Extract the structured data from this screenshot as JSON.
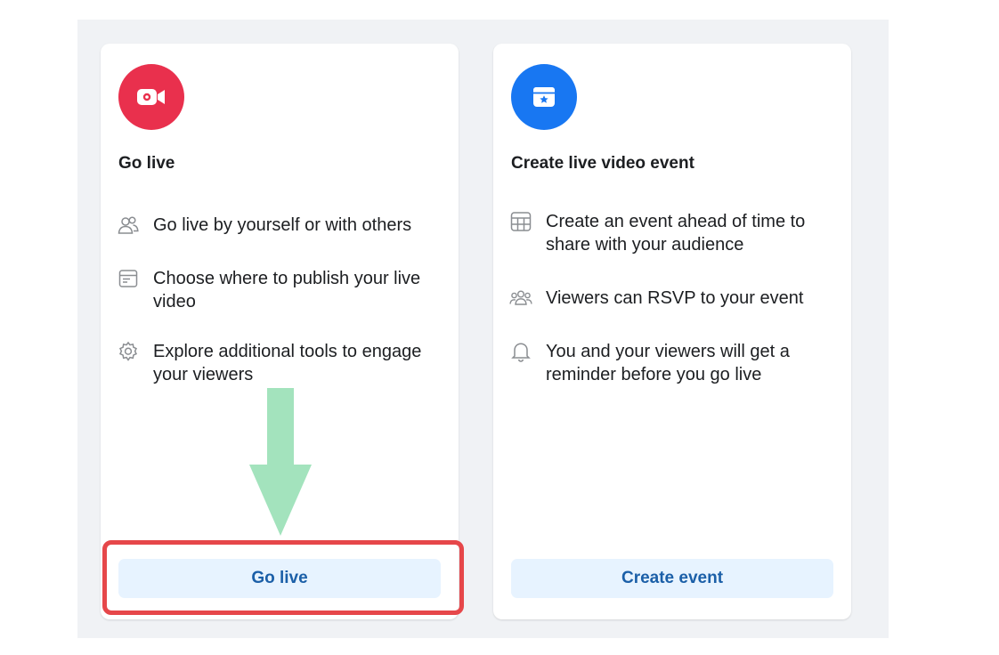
{
  "colors": {
    "panel_bg": "#f0f2f5",
    "go_live_circle": "#e9304d",
    "event_circle": "#1877f2",
    "button_bg": "#e7f3ff",
    "button_text": "#1b5fa8",
    "highlight_border": "#e6474a",
    "arrow": "#a3e3bd"
  },
  "go_live_card": {
    "icon": "video-camera-icon",
    "title": "Go live",
    "features": [
      {
        "icon": "people-icon",
        "text": "Go live by yourself or with others"
      },
      {
        "icon": "browser-window-icon",
        "text": "Choose where to publish your live video"
      },
      {
        "icon": "gear-icon",
        "text": "Explore additional tools to engage your viewers"
      }
    ],
    "button_label": "Go live"
  },
  "event_card": {
    "icon": "calendar-star-icon",
    "title": "Create live video event",
    "features": [
      {
        "icon": "calendar-grid-icon",
        "text": "Create an event ahead of time to share with your audience"
      },
      {
        "icon": "group-icon",
        "text": "Viewers can RSVP to your event"
      },
      {
        "icon": "bell-icon",
        "text": "You and your viewers will get a reminder before you go live"
      }
    ],
    "button_label": "Create event"
  }
}
